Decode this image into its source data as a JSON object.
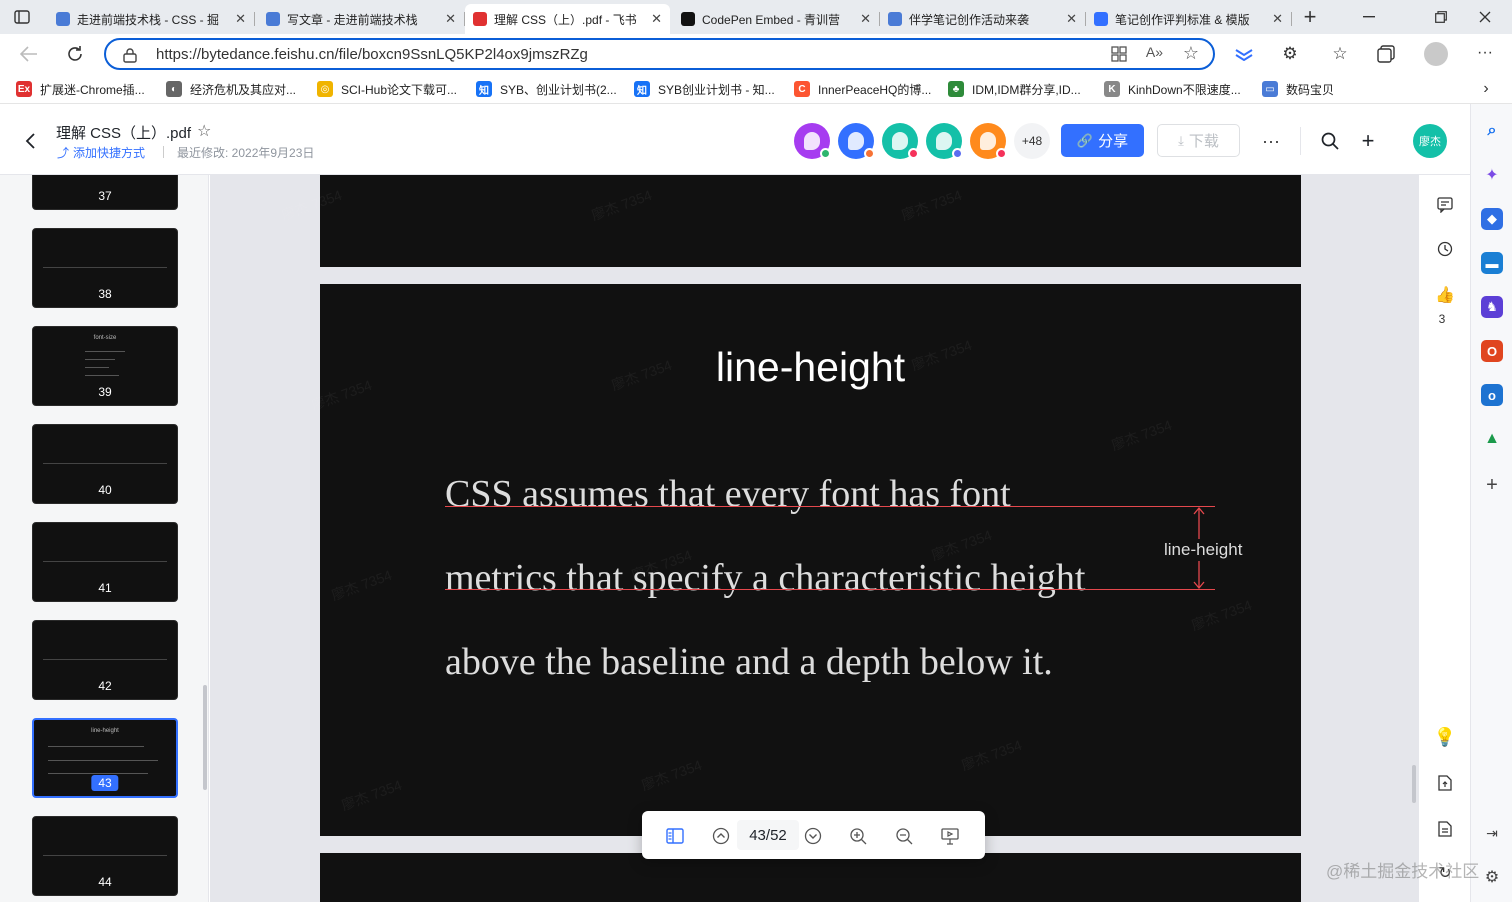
{
  "tabs": [
    {
      "label": "走进前端技术栈 - CSS - 掘",
      "active": false
    },
    {
      "label": "写文章 - 走进前端技术栈",
      "active": false
    },
    {
      "label": "理解 CSS（上）.pdf - 飞书",
      "active": true
    },
    {
      "label": "CodePen Embed - 青训营",
      "active": false
    },
    {
      "label": "伴学笔记创作活动来袭",
      "active": false
    },
    {
      "label": "笔记创作评判标准 & 模版",
      "active": false
    }
  ],
  "address": {
    "url": "https://bytedance.feishu.cn/file/boxcn9SsnLQ5KP2l4ox9jmszRZg"
  },
  "bookmarks": [
    {
      "label": "扩展迷-Chrome插...",
      "icon": "extfans-icon",
      "glyph": "Ex"
    },
    {
      "label": "经济危机及其应对...",
      "icon": "globe-icon",
      "glyph": "◐"
    },
    {
      "label": "SCI-Hub论文下载可...",
      "icon": "scihub-icon",
      "glyph": "◎"
    },
    {
      "label": "SYB、创业计划书(2...",
      "icon": "zhihu-icon",
      "glyph": "知"
    },
    {
      "label": "SYB创业计划书 - 知...",
      "icon": "zhihu-icon",
      "glyph": "知"
    },
    {
      "label": "InnerPeaceHQ的博...",
      "icon": "csdn-icon",
      "glyph": "C"
    },
    {
      "label": "IDM,IDM群分享,ID...",
      "icon": "tree-icon",
      "glyph": "♣"
    },
    {
      "label": "KinhDown不限速度...",
      "icon": "kinhdown-icon",
      "glyph": "K"
    },
    {
      "label": "数码宝贝",
      "icon": "folder-icon",
      "glyph": "▭"
    }
  ],
  "doc": {
    "title": "理解 CSS（上）.pdf",
    "shortcut": "添加快捷方式",
    "modified": "最近修改: 2022年9月23日",
    "extra_collaborators": "+48",
    "share": "分享",
    "download": "下载",
    "user_avatar": "廖杰"
  },
  "avatars": [
    {
      "bg": "#a63cf0",
      "dot": "#2db56e"
    },
    {
      "bg": "#3370ff",
      "dot": "#f77234"
    },
    {
      "bg": "#14c0a8",
      "dot": "#f5315a"
    },
    {
      "bg": "#14c0a8",
      "dot": "#5a6cf0"
    },
    {
      "bg": "#ff8a1c",
      "dot": "#f5315a"
    }
  ],
  "thumbnails": [
    {
      "num": "37",
      "selected": false
    },
    {
      "num": "38",
      "selected": false
    },
    {
      "num": "39",
      "selected": false,
      "title": "font-size"
    },
    {
      "num": "40",
      "selected": false
    },
    {
      "num": "41",
      "selected": false
    },
    {
      "num": "42",
      "selected": false
    },
    {
      "num": "43",
      "selected": true,
      "title": "line-height"
    },
    {
      "num": "44",
      "selected": false
    }
  ],
  "slide": {
    "title": "line-height",
    "line1": "CSS assumes that every font has font",
    "line2": "metrics that specify a characteristic height",
    "line3": "above the baseline and a depth below it.",
    "annotation": "line-height"
  },
  "pager": {
    "page": "43/52"
  },
  "likes": "3",
  "watermark": "廖杰 7354",
  "site_watermark": "@稀土掘金技术社区",
  "colors": {
    "accent": "#3370ff",
    "edge_blue": "#0b5ed7",
    "slide_bg": "#111111",
    "guide_red": "#e5484d"
  }
}
